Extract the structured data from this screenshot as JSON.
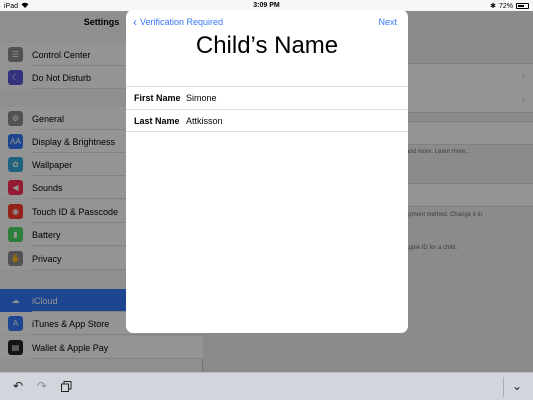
{
  "status_bar": {
    "device": "iPad",
    "time": "3:09 PM",
    "battery_text": "72%",
    "battery_level": 0.72
  },
  "sidebar": {
    "title": "Settings",
    "items": [
      {
        "label": "Control Center",
        "icon": "control-center-icon",
        "color": "#8e8e93",
        "glyph": "☰"
      },
      {
        "label": "Do Not Disturb",
        "icon": "moon-icon",
        "color": "#5856d6",
        "glyph": "☾"
      },
      {
        "label": "General",
        "icon": "gear-icon",
        "color": "#8e8e93",
        "glyph": "⚙"
      },
      {
        "label": "Display & Brightness",
        "icon": "display-icon",
        "color": "#3478f6",
        "glyph": "AA"
      },
      {
        "label": "Wallpaper",
        "icon": "wallpaper-icon",
        "color": "#34aadc",
        "glyph": "✿"
      },
      {
        "label": "Sounds",
        "icon": "speaker-icon",
        "color": "#ff2d55",
        "glyph": "◀"
      },
      {
        "label": "Touch ID & Passcode",
        "icon": "fingerprint-icon",
        "color": "#ff3b30",
        "glyph": "◉"
      },
      {
        "label": "Battery",
        "icon": "battery-icon",
        "color": "#4cd964",
        "glyph": "▮"
      },
      {
        "label": "Privacy",
        "icon": "hand-icon",
        "color": "#8e8e93",
        "glyph": "✋"
      },
      {
        "label": "iCloud",
        "icon": "cloud-icon",
        "color": "#3478f6",
        "glyph": "☁"
      },
      {
        "label": "iTunes & App Store",
        "icon": "app-store-icon",
        "color": "#3478f6",
        "glyph": "A"
      },
      {
        "label": "Wallet & Apple Pay",
        "icon": "wallet-icon",
        "color": "#222222",
        "glyph": "▤"
      }
    ]
  },
  "detail": {
    "note1": "on, and more. Learn more...",
    "note2": "payment method. Change it in",
    "note3": "n Apple ID for a child."
  },
  "modal": {
    "back_label": "Verification Required",
    "next_label": "Next",
    "title": "Child’s Name",
    "first_name_label": "First Name",
    "first_name_value": "Simone",
    "last_name_label": "Last Name",
    "last_name_value": "Attkisson"
  },
  "colors": {
    "accent": "#3478f6"
  }
}
